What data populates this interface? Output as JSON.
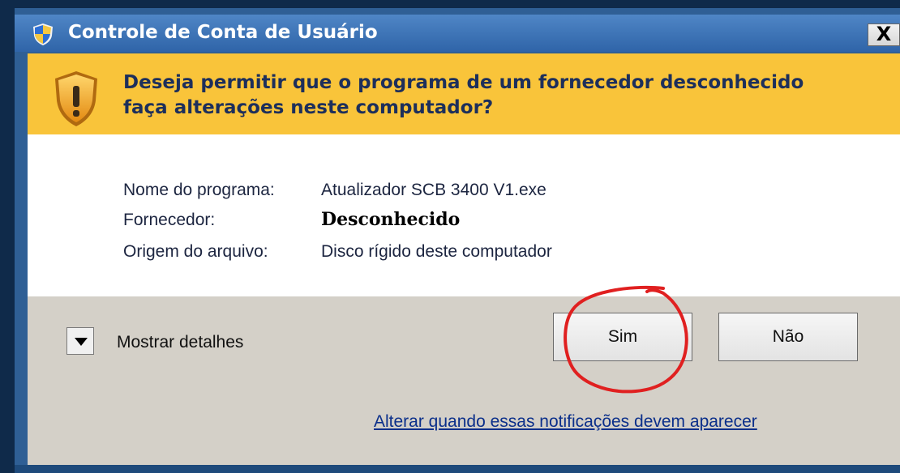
{
  "window": {
    "title": "Controle de Conta de Usuário",
    "close_label": "X"
  },
  "prompt": {
    "question_line1": "Deseja permitir que o programa de um fornecedor desconhecido",
    "question_line2": "faça alterações neste computador?"
  },
  "details": {
    "program_label": "Nome do programa:",
    "program_value": "Atualizador SCB 3400 V1.exe",
    "publisher_label": "Fornecedor:",
    "publisher_value": "Desconhecido",
    "origin_label": "Origem do arquivo:",
    "origin_value": "Disco rígido deste computador"
  },
  "footer": {
    "show_details_label": "Mostrar detalhes",
    "yes_label": "Sim",
    "no_label": "Não",
    "notifications_link": "Alterar quando essas notificações devem aparecer"
  },
  "colors": {
    "titlebar": "#2f64a8",
    "warning_band": "#f9c43a",
    "footer_bg": "#d4d0c8",
    "annotation": "#e02020",
    "link": "#0b2f8a"
  },
  "icons": {
    "title": "uac-shield-icon",
    "warning": "warning-shield-icon",
    "toggle": "chevron-down-icon"
  }
}
